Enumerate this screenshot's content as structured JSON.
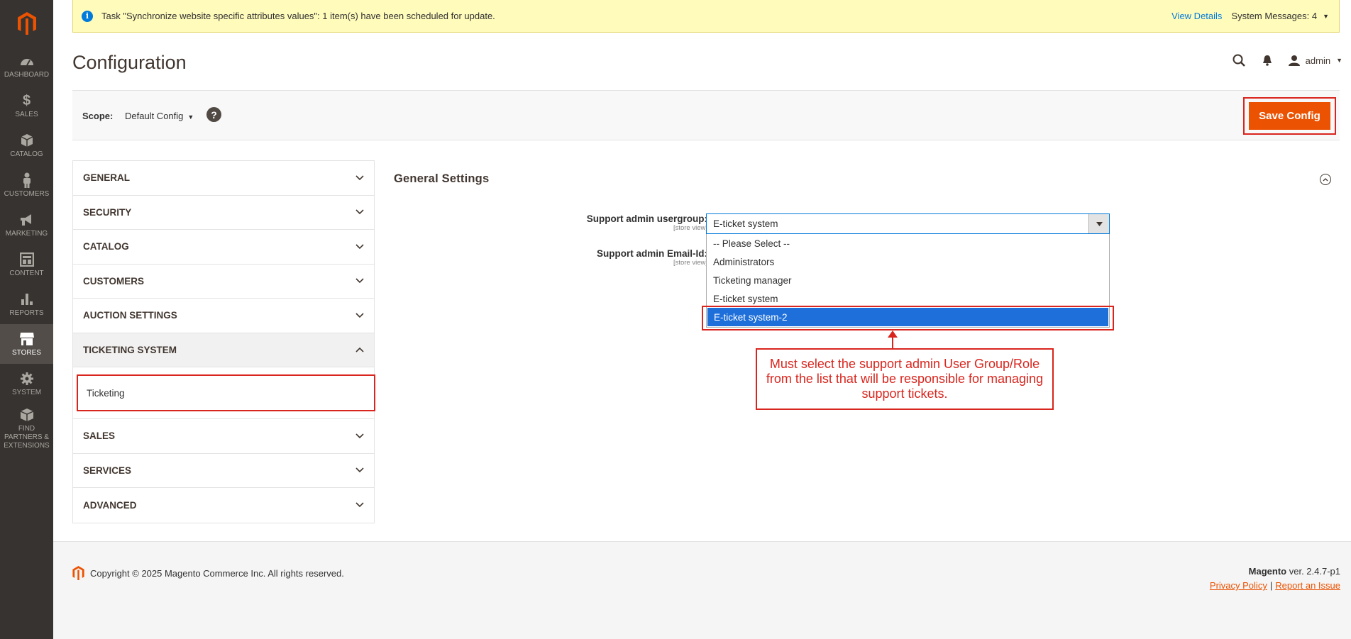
{
  "sidebar": {
    "items": [
      {
        "label": "DASHBOARD",
        "icon": "dashboard-icon"
      },
      {
        "label": "SALES",
        "icon": "dollar-icon"
      },
      {
        "label": "CATALOG",
        "icon": "cube-icon"
      },
      {
        "label": "CUSTOMERS",
        "icon": "person-icon"
      },
      {
        "label": "MARKETING",
        "icon": "megaphone-icon"
      },
      {
        "label": "CONTENT",
        "icon": "layout-icon"
      },
      {
        "label": "REPORTS",
        "icon": "bar-chart-icon"
      },
      {
        "label": "STORES",
        "icon": "store-icon"
      },
      {
        "label": "SYSTEM",
        "icon": "gear-icon"
      },
      {
        "label": "FIND PARTNERS & EXTENSIONS",
        "icon": "box-icon"
      }
    ],
    "active": "STORES"
  },
  "system_message": {
    "text": "Task \"Synchronize website specific attributes values\": 1 item(s) have been scheduled for update.",
    "view_details": "View Details",
    "count_label": "System Messages: 4"
  },
  "header": {
    "title": "Configuration",
    "user": "admin"
  },
  "scope": {
    "label": "Scope:",
    "value": "Default Config",
    "help": "?"
  },
  "actions": {
    "save_label": "Save Config"
  },
  "tabs": [
    "GENERAL",
    "SECURITY",
    "CATALOG",
    "CUSTOMERS",
    "AUCTION SETTINGS",
    "TICKETING SYSTEM",
    "SALES",
    "SERVICES",
    "ADVANCED"
  ],
  "subtab": "Ticketing",
  "section": {
    "title": "General Settings",
    "fields": [
      {
        "label": "Support admin usergroup:",
        "scope": "[store view]"
      },
      {
        "label": "Support admin Email-Id:",
        "scope": "[store view]"
      }
    ],
    "select_value": "E-ticket system",
    "options": [
      "-- Please Select --",
      "Administrators",
      "Ticketing manager",
      "E-ticket system",
      "E-ticket system-2"
    ]
  },
  "annotation": {
    "text": "Must select the support admin User Group/Role from the list that will be responsible for managing support tickets.",
    "color": "#d9251d"
  },
  "footer": {
    "copyright": "Copyright © 2025 Magento Commerce Inc. All rights reserved.",
    "brand": "Magento",
    "version": " ver. 2.4.7-p1",
    "privacy": "Privacy Policy",
    "separator": "|",
    "report": "Report an Issue"
  },
  "colors": {
    "accent": "#eb5202",
    "sidebar": "#373330",
    "link": "#007bdb",
    "selected_option": "#1e6fd9"
  }
}
